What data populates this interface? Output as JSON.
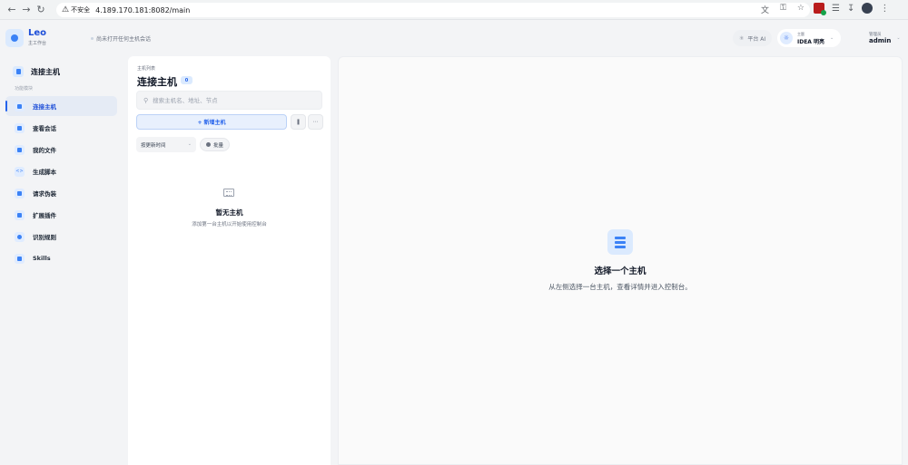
{
  "browser": {
    "security_label": "不安全",
    "url": "4.189.170.181:8082/main"
  },
  "header": {
    "brand_name": "Leo",
    "brand_sub": "主工作台",
    "session_hint": "尚未打开任何主机会话",
    "ai_button": "平台 AI",
    "theme_small": "主题",
    "theme_label": "IDEA 明亮",
    "admin_role": "管理员",
    "admin_name": "admin"
  },
  "sidebar": {
    "title": "连接主机",
    "section_label": "功能模块",
    "items": [
      {
        "label": "连接主机",
        "icon": "server-icon",
        "active": true
      },
      {
        "label": "查看会话",
        "icon": "cloud-icon",
        "active": false
      },
      {
        "label": "我的文件",
        "icon": "folder-icon",
        "active": false
      },
      {
        "label": "生成脚本",
        "icon": "code-icon",
        "active": false
      },
      {
        "label": "请求伪装",
        "icon": "monitor-icon",
        "active": false
      },
      {
        "label": "扩展插件",
        "icon": "puzzle-icon",
        "active": false
      },
      {
        "label": "识别规则",
        "icon": "gear-icon",
        "active": false
      },
      {
        "label": "Skills",
        "icon": "book-icon",
        "active": false
      }
    ]
  },
  "host_list": {
    "subtitle": "主机列表",
    "title": "连接主机",
    "count": "0",
    "search_placeholder": "搜索主机名、地址、节点",
    "add_button": "+ 新增主机",
    "sort_label": "按更新时间",
    "batch_label": "批量",
    "empty_title": "暂无主机",
    "empty_desc": "添加第一台主机以开始使用控制台"
  },
  "main": {
    "title": "选择一个主机",
    "desc": "从左侧选择一台主机，查看详情并进入控制台。"
  },
  "colors": {
    "accent": "#2563eb",
    "accent_light": "#dbeafe",
    "page_bg": "#f3f4f6"
  }
}
